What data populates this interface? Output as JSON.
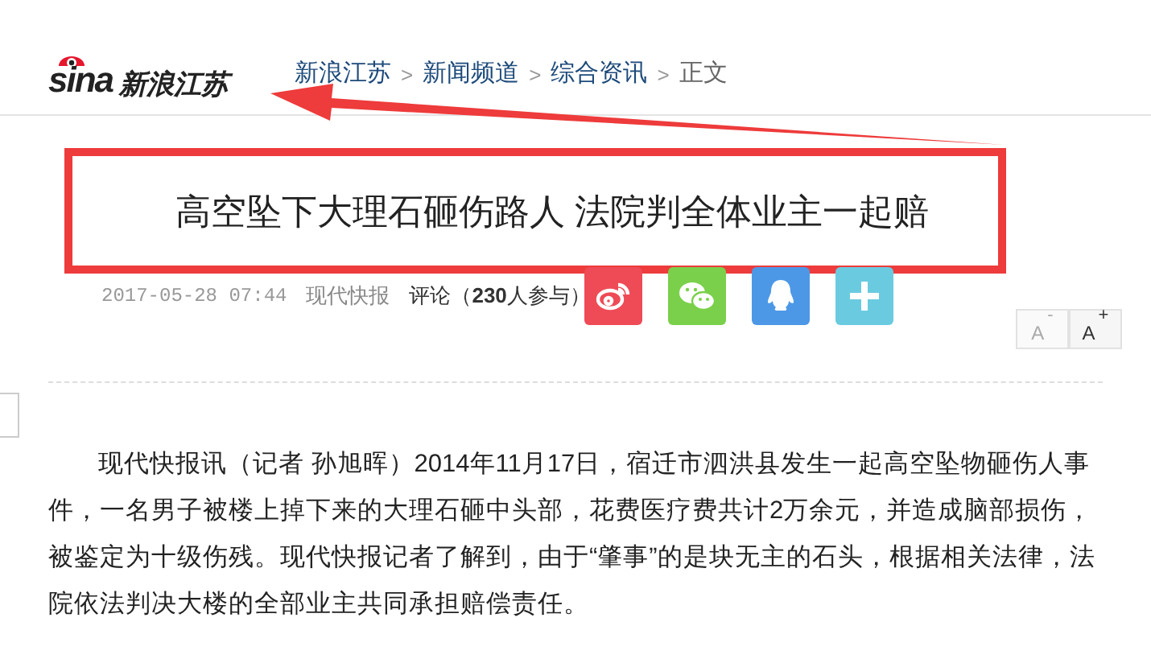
{
  "header": {
    "logo_mark": "sina",
    "logo_text": "新浪江苏"
  },
  "breadcrumb": {
    "separator": ">",
    "items": [
      "新浪江苏",
      "新闻频道",
      "综合资讯",
      "正文"
    ]
  },
  "article": {
    "title": "高空坠下大理石砸伤路人 法院判全体业主一起赔",
    "date": "2017-05-28 07:44",
    "source": "现代快报",
    "comments_label": "评论（",
    "comments_count": "230",
    "comments_suffix": "人参与）",
    "share": [
      {
        "kind": "weibo",
        "color": "#ee4b57"
      },
      {
        "kind": "wechat",
        "color": "#7ad04a"
      },
      {
        "kind": "qq",
        "color": "#4d98e6"
      },
      {
        "kind": "more",
        "color": "#6acbe0"
      }
    ],
    "font_buttons": [
      {
        "letter": "A",
        "sign": "-",
        "disabled": true
      },
      {
        "letter": "A",
        "sign": "+",
        "disabled": false
      }
    ],
    "body": "现代快报讯（记者 孙旭晖）2014年11月17日，宿迁市泗洪县发生一起高空坠物砸伤人事件，一名男子被楼上掉下来的大理石砸中头部，花费医疗费共计2万余元，并造成脑部损伤，被鉴定为十级伤残。现代快报记者了解到，由于“肇事”的是块无主的石头，根据相关法律，法院依法判决大楼的全部业主共同承担赔偿责任。"
  }
}
